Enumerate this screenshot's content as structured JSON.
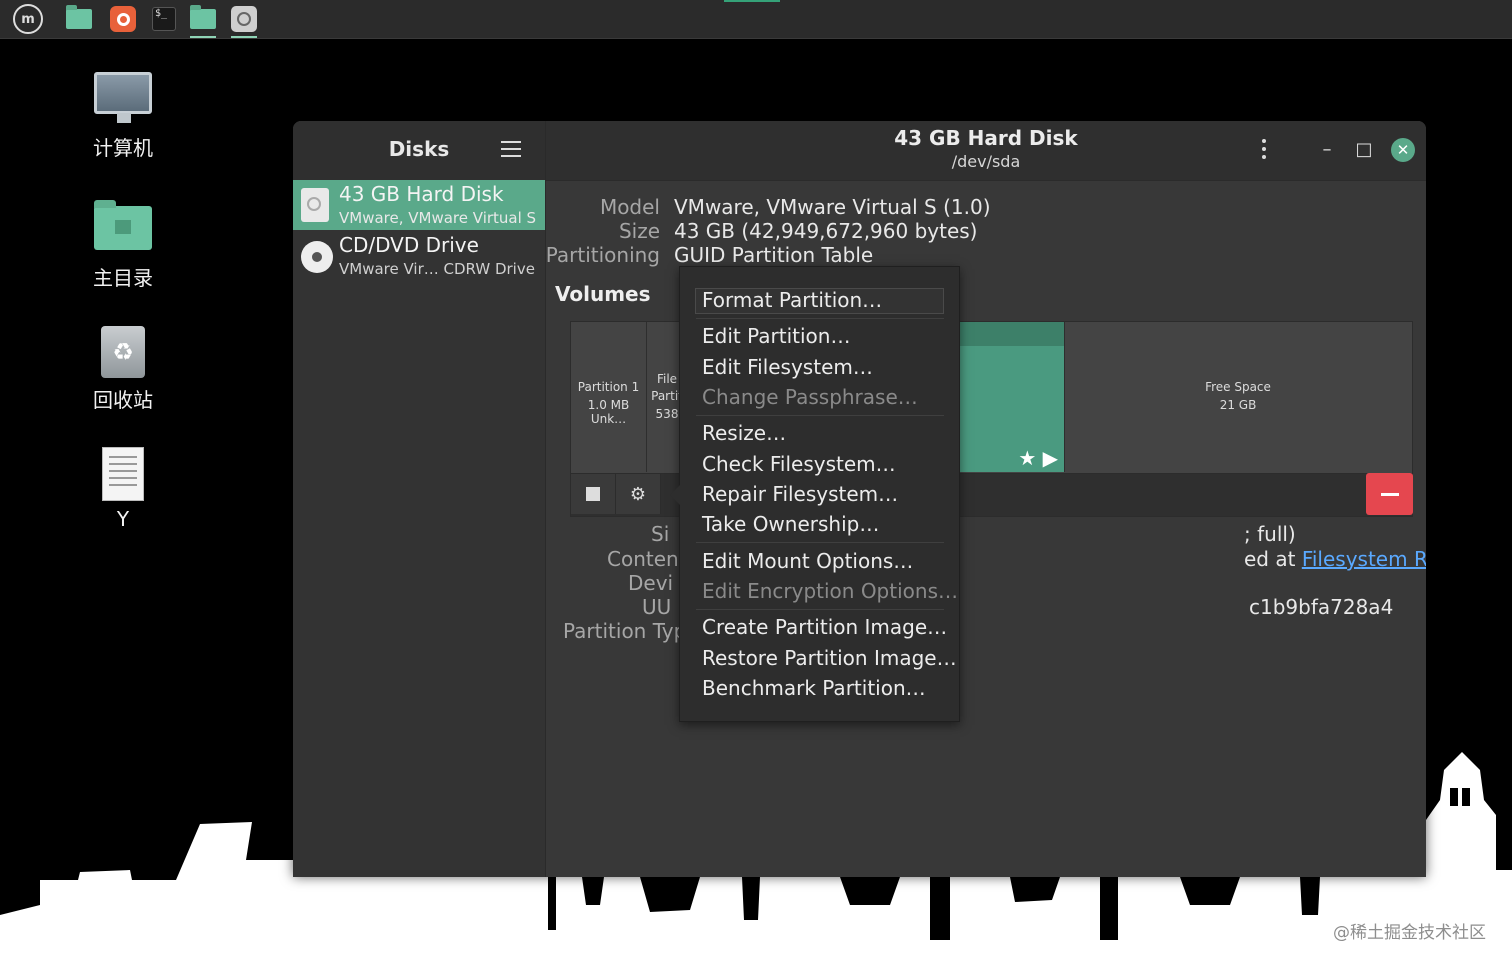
{
  "taskbar": {
    "items": [
      {
        "name": "menu",
        "label": "m"
      },
      {
        "name": "files"
      },
      {
        "name": "firefox"
      },
      {
        "name": "terminal",
        "label": "$_"
      },
      {
        "name": "folder-active"
      },
      {
        "name": "disks-active"
      }
    ]
  },
  "desktop": {
    "icons": [
      {
        "label": "计算机",
        "icon": "computer-icon"
      },
      {
        "label": "主目录",
        "icon": "home-folder-icon"
      },
      {
        "label": "回收站",
        "icon": "trash-icon"
      },
      {
        "label": "Y",
        "icon": "document-icon"
      }
    ]
  },
  "sidebar": {
    "title": "Disks",
    "devices": [
      {
        "name": "43 GB Hard Disk",
        "sub": "VMware, VMware Virtual S",
        "selected": true
      },
      {
        "name": "CD/DVD Drive",
        "sub": "VMware Vir… CDRW Drive",
        "selected": false
      }
    ]
  },
  "header": {
    "title": "43 GB Hard Disk",
    "subtitle": "/dev/sda",
    "minimize": "–",
    "maximize": "□",
    "close": "✕"
  },
  "disk_info": {
    "model_label": "Model",
    "model": "VMware, VMware Virtual S (1.0)",
    "size_label": "Size",
    "size": "43 GB (42,949,672,960 bytes)",
    "partitioning_label": "Partitioning",
    "partitioning": "GUID Partition Table"
  },
  "volumes": {
    "title": "Volumes",
    "segments": [
      {
        "line1": "Partition 1",
        "line2": "1.0 MB Unk…"
      },
      {
        "line1": "File",
        "line2": "Partit",
        "line3": "538"
      },
      {
        "selected_marker": "★ ▶"
      },
      {
        "line1": "Free Space",
        "line2": "21 GB"
      }
    ]
  },
  "details": {
    "size_label": "Si",
    "size_value": "; full)",
    "contents_label": "Conten",
    "contents_value": "ed at ",
    "contents_link": "Filesystem Root",
    "device_label": "Devi",
    "uuid_label": "UU",
    "uuid_value": "c1b9bfa728a4",
    "ptype_label": "Partition Typ"
  },
  "context_menu": {
    "items": [
      {
        "label": "Format Partition…",
        "disabled": false
      },
      {
        "label": "Edit Partition…",
        "disabled": false
      },
      {
        "label": "Edit Filesystem…",
        "disabled": false
      },
      {
        "label": "Change Passphrase…",
        "disabled": true
      },
      {
        "label": "Resize…",
        "disabled": false
      },
      {
        "label": "Check Filesystem…",
        "disabled": false
      },
      {
        "label": "Repair Filesystem…",
        "disabled": false
      },
      {
        "label": "Take Ownership…",
        "disabled": false
      },
      {
        "label": "Edit Mount Options…",
        "disabled": false
      },
      {
        "label": "Edit Encryption Options…",
        "disabled": true
      },
      {
        "label": "Create Partition Image…",
        "disabled": false
      },
      {
        "label": "Restore Partition Image…",
        "disabled": false
      },
      {
        "label": "Benchmark Partition…",
        "disabled": false
      }
    ]
  },
  "watermark": "@稀土掘金技术社区",
  "colors": {
    "accent": "#5aa98a",
    "danger": "#e5474f",
    "link": "#5aa9ff"
  }
}
